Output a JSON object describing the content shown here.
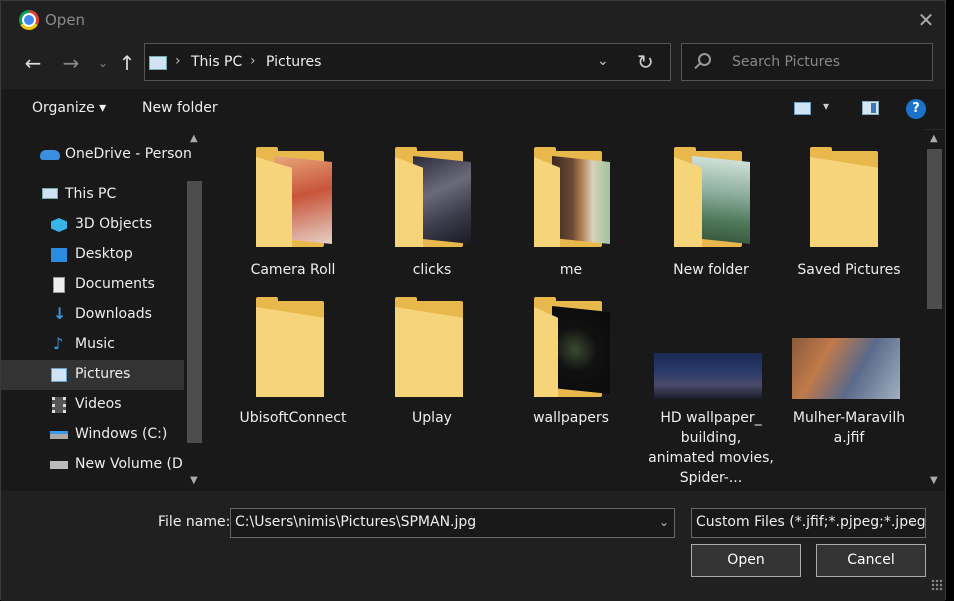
{
  "window": {
    "title": "Open"
  },
  "address": {
    "crumbs": [
      "This PC",
      "Pictures"
    ]
  },
  "search": {
    "placeholder": "Search Pictures"
  },
  "toolbar": {
    "organize": "Organize ▾",
    "new_folder": "New folder",
    "help": "?"
  },
  "sidebar": {
    "items": [
      {
        "label": "OneDrive - Person",
        "icon": "onedrive-icon"
      },
      {
        "label": "This PC",
        "icon": "computer-icon"
      },
      {
        "label": "3D Objects",
        "icon": "cube-icon"
      },
      {
        "label": "Desktop",
        "icon": "desktop-icon"
      },
      {
        "label": "Documents",
        "icon": "document-icon"
      },
      {
        "label": "Downloads",
        "icon": "download-icon"
      },
      {
        "label": "Music",
        "icon": "music-icon"
      },
      {
        "label": "Pictures",
        "icon": "pictures-icon",
        "selected": true
      },
      {
        "label": "Videos",
        "icon": "video-icon"
      },
      {
        "label": "Windows (C:)",
        "icon": "drive-icon"
      },
      {
        "label": "New Volume (D:)",
        "icon": "drive-icon"
      }
    ]
  },
  "files": [
    {
      "name": "Camera Roll",
      "type": "folder"
    },
    {
      "name": "clicks",
      "type": "folder"
    },
    {
      "name": "me",
      "type": "folder"
    },
    {
      "name": "New folder",
      "type": "folder"
    },
    {
      "name": "Saved Pictures",
      "type": "folder"
    },
    {
      "name": "UbisoftConnect",
      "type": "folder"
    },
    {
      "name": "Uplay",
      "type": "folder"
    },
    {
      "name": "wallpapers",
      "type": "folder"
    },
    {
      "name": "HD wallpaper_ building, animated movies, Spider-...",
      "type": "image"
    },
    {
      "name": "Mulher-Maravilha.jfif",
      "type": "image"
    }
  ],
  "bottom": {
    "file_name_label": "File name:",
    "file_name_value": "C:\\Users\\nimis\\Pictures\\SPMAN.jpg",
    "filter_value": "Custom Files (*.jfif;*.pjpeg;*.jpeg;*.pjp;*.jpg)",
    "open_label": "Open",
    "cancel_label": "Cancel"
  },
  "colors": {
    "background": "#191919",
    "folder": "#f6d47a",
    "accent": "#1a73c8"
  }
}
